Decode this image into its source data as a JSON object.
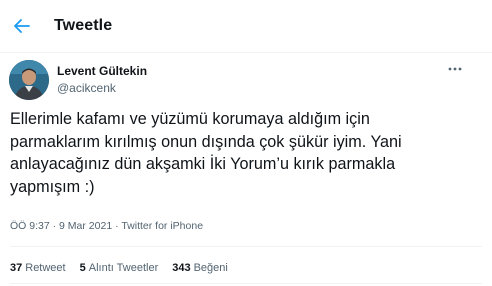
{
  "header": {
    "title": "Tweetle",
    "back_icon": "arrow-left-icon",
    "accent": "#1d9bf0"
  },
  "author": {
    "display_name": "Levent Gültekin",
    "handle": "@acikcenk",
    "more_icon": "more-horizontal-icon"
  },
  "tweet": {
    "text": "Ellerimle kafamı ve yüzümü korumaya aldığım için\nparmaklarım kırılmış onun dışında çok şükür iyim. Yani\nanlayacağınız dün akşamki İki Yorum’u kırık parmakla\nyapmışım :)",
    "time": "ÖÖ 9:37",
    "date": "9 Mar 2021",
    "separator": " · ",
    "source": "Twitter for iPhone"
  },
  "stats": {
    "retweets_count": "37",
    "retweets_label": "Retweet",
    "quotes_count": "5",
    "quotes_label": "Alıntı Tweetler",
    "likes_count": "343",
    "likes_label": "Beğeni"
  }
}
